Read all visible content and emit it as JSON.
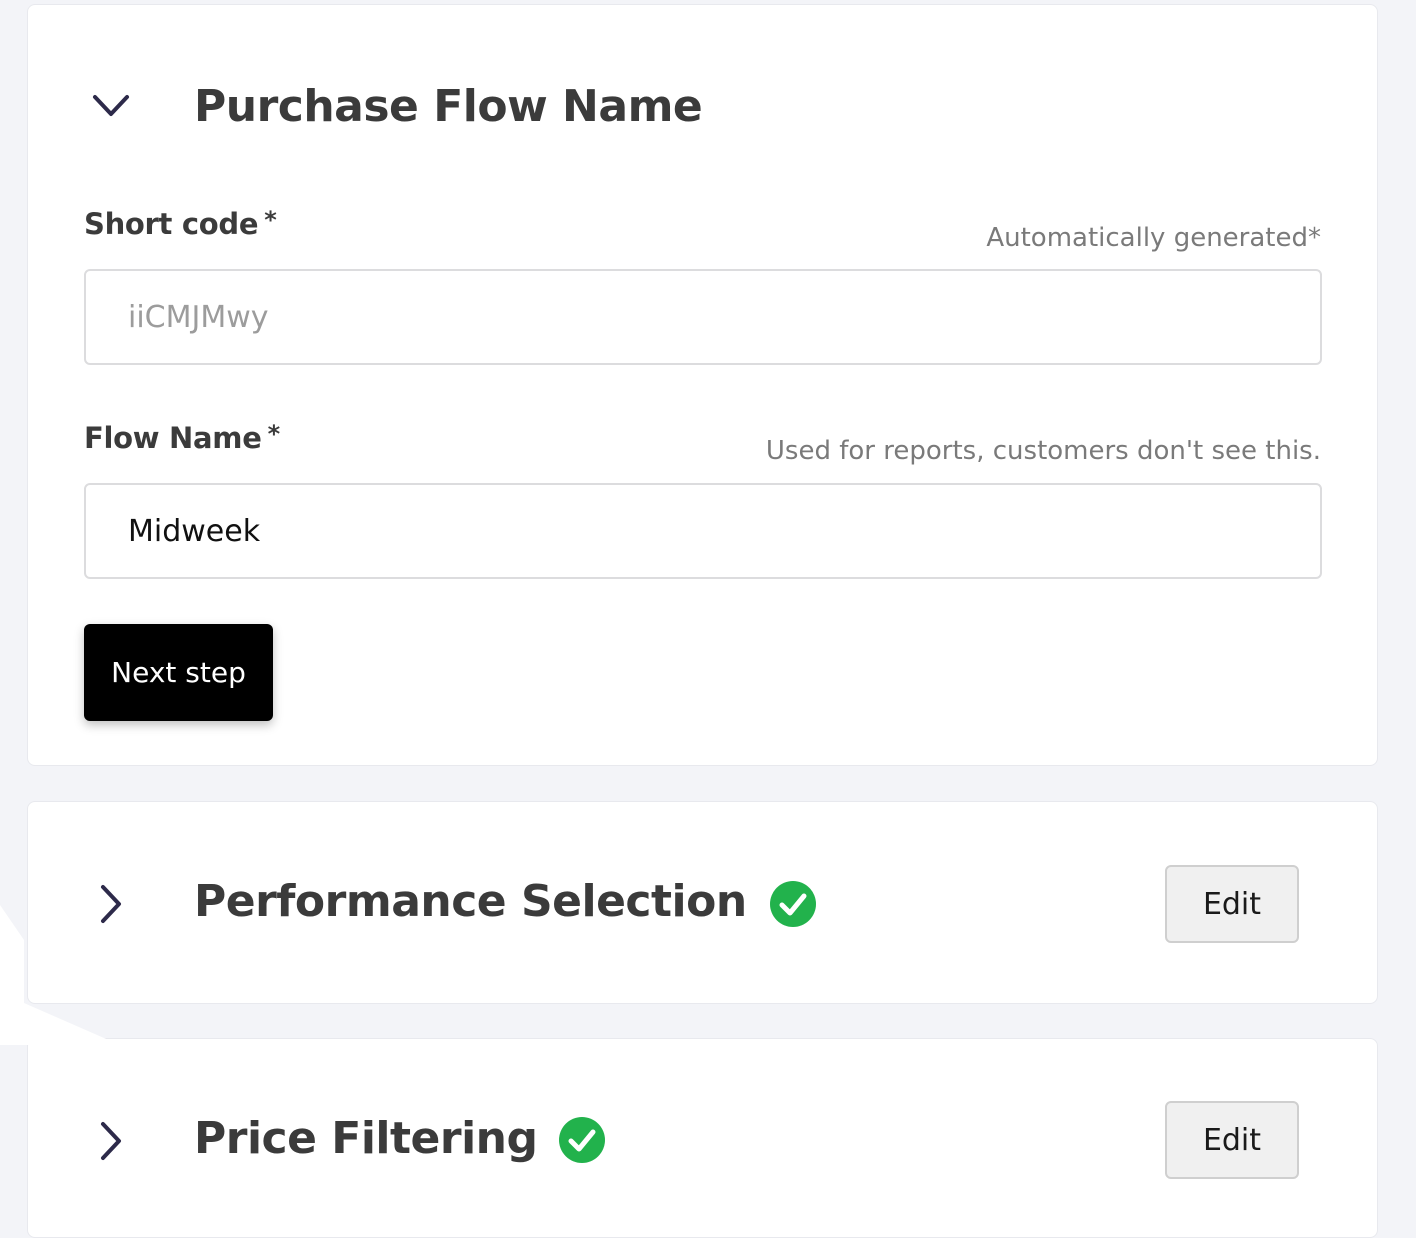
{
  "purchase_flow": {
    "title": "Purchase Flow Name",
    "short_code": {
      "label": "Short code",
      "required_mark": "*",
      "hint": "Automatically generated*",
      "placeholder": "iiCMJMwy",
      "value": ""
    },
    "flow_name": {
      "label": "Flow Name",
      "required_mark": "*",
      "hint": "Used for reports, customers don't see this.",
      "value": "Midweek"
    },
    "next_label": "Next step"
  },
  "sections": [
    {
      "title": "Performance Selection",
      "status": "complete",
      "edit_label": "Edit"
    },
    {
      "title": "Price Filtering",
      "status": "complete",
      "edit_label": "Edit"
    }
  ],
  "icons": {
    "expanded": "chevron-down-icon",
    "collapsed": "chevron-right-icon",
    "status": "check-circle-icon"
  },
  "colors": {
    "primary_button": "#000000",
    "success": "#22b24c",
    "chevron": "#2d2a4a",
    "title_text": "#3b3b3b",
    "hint_text": "#7a7a7a"
  }
}
